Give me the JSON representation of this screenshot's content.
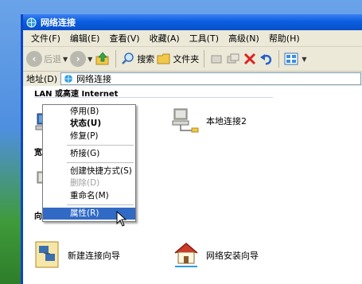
{
  "window": {
    "title": "网络连接"
  },
  "menubar": [
    "文件(F)",
    "编辑(E)",
    "查看(V)",
    "收藏(A)",
    "工具(T)",
    "高级(N)",
    "帮助(H)"
  ],
  "toolbar": {
    "back": "后退",
    "search": "搜索",
    "folders": "文件夹"
  },
  "address": {
    "label": "地址(D)",
    "value": "网络连接"
  },
  "groups": {
    "lan": "LAN 或高速 Internet",
    "broadband": "宽带",
    "wizard": "向导"
  },
  "items": {
    "local2": "本地连接2",
    "new_wizard": "新建连接向导",
    "net_setup": "网络安装向导"
  },
  "context_menu": {
    "disable": "停用(B)",
    "status": "状态(U)",
    "repair": "修复(P)",
    "bridge": "桥接(G)",
    "shortcut": "创建快捷方式(S)",
    "delete": "删除(D)",
    "rename": "重命名(M)",
    "properties": "属性(R)"
  },
  "colors": {
    "highlight": "#316ac5",
    "titlebar": "#0a5ee0"
  }
}
